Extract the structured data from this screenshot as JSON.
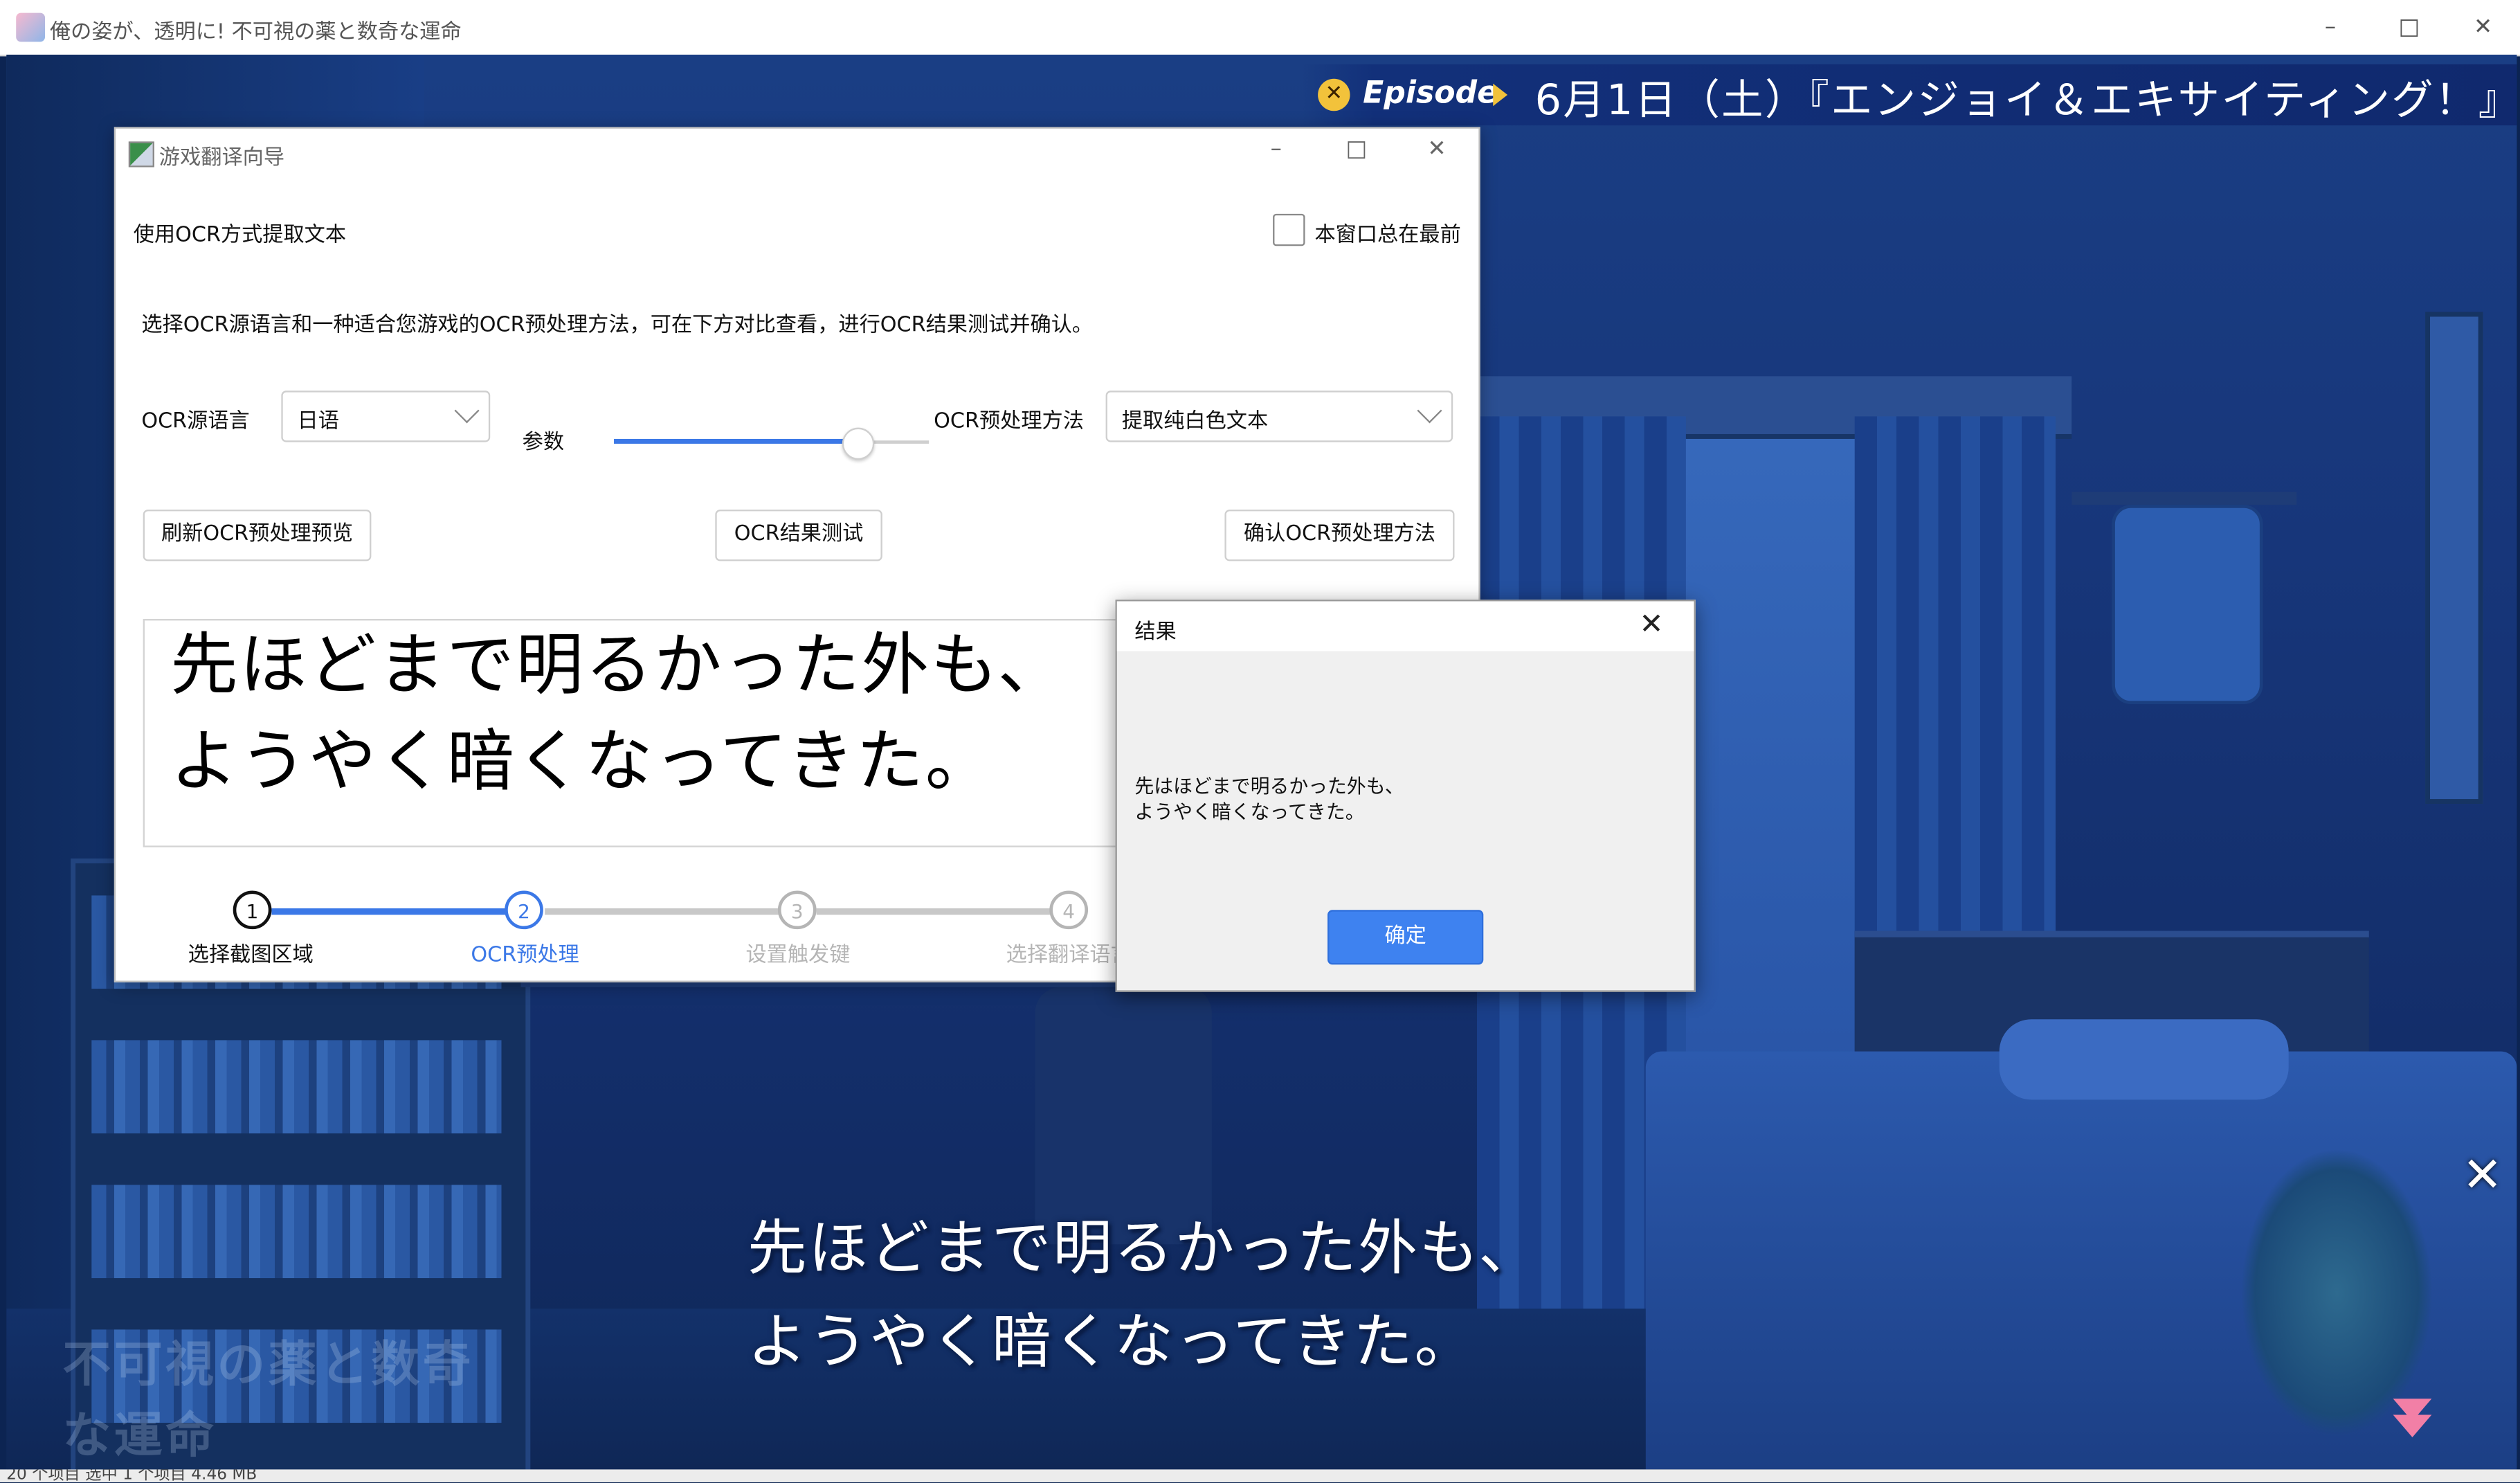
{
  "game_window": {
    "title": "俺の姿が、透明に! 不可視の薬と数奇な運命",
    "minimize_icon": "minimize-icon",
    "maximize_icon": "maximize-icon",
    "close_icon": "close-icon"
  },
  "episode": {
    "label": "Episode",
    "title": "6月1日（土）『エンジョイ＆エキサイティング！』"
  },
  "dialogue": {
    "line1": "先ほどまで明るかった外も、",
    "line2": "ようやく暗くなってきた。"
  },
  "watermark_text": "不可視の薬と数奇な運命",
  "statusbar": {
    "text": "20 个项目    选中 1 个项目  4.46 MB"
  },
  "wizard": {
    "title": "游戏翻译向导",
    "heading": "使用OCR方式提取文本",
    "always_on_top_label": "本窗口总在最前",
    "always_on_top_checked": false,
    "description": "选择OCR源语言和一种适合您游戏的OCR预处理方法，可在下方对比查看，进行OCR结果测试并确认。",
    "source_language_label": "OCR源语言",
    "source_language_value": "日语",
    "param_label": "参数",
    "param_value": 0.8,
    "method_label": "OCR预处理方法",
    "method_value": "提取纯白色文本",
    "refresh_button": "刷新OCR预处理预览",
    "test_button": "OCR结果测试",
    "confirm_button": "确认OCR预处理方法",
    "preview_line1": "先ほどまで明るかった外も、",
    "preview_line2": "ようやく暗くなってきた。",
    "steps": [
      {
        "num": "1",
        "label": "选择截图区域",
        "state": "done"
      },
      {
        "num": "2",
        "label": "OCR预处理",
        "state": "active"
      },
      {
        "num": "3",
        "label": "设置触发键",
        "state": "pending"
      },
      {
        "num": "4",
        "label": "选择翻译语言",
        "state": "pending"
      }
    ]
  },
  "result_dialog": {
    "title": "结果",
    "text": "先はほどまで明るかった外も、\nようやく暗くなってきた。",
    "ok_button": "确定"
  },
  "colors": {
    "accent": "#3b78e7",
    "ok_button": "#3e82f0",
    "episode_badge": "#f2c23b",
    "next_arrow": "#f27fa6",
    "step_pending": "#b5b5b5"
  }
}
